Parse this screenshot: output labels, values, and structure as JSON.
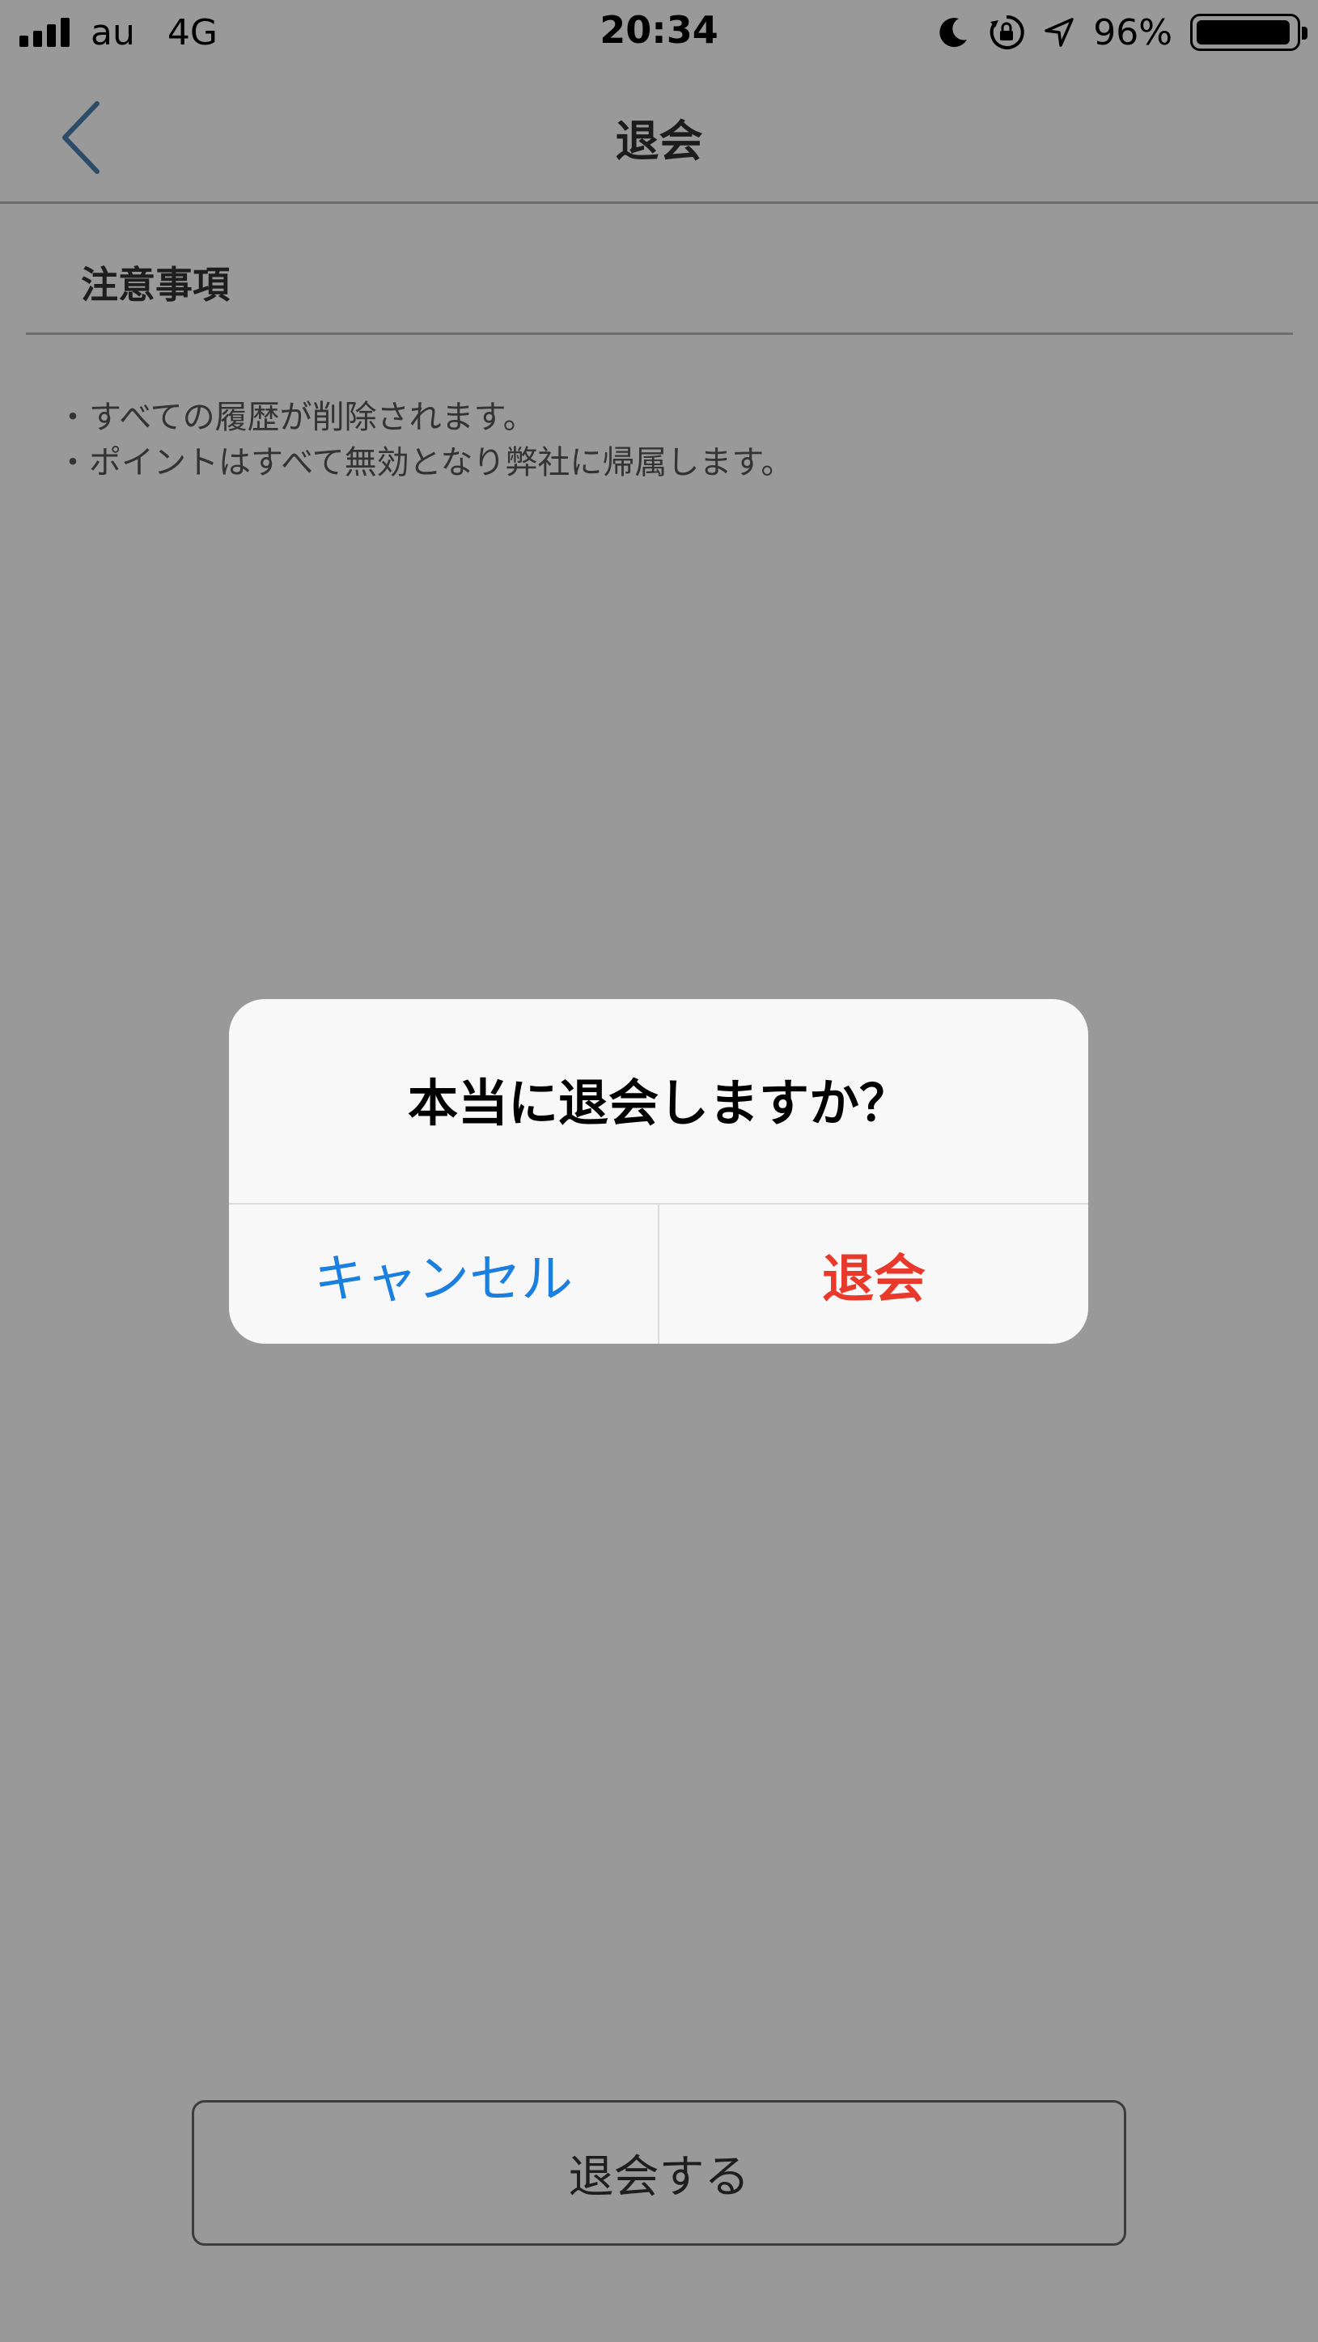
{
  "status_bar": {
    "carrier": "au",
    "network": "4G",
    "time": "20:34",
    "battery_percent": "96%",
    "battery_level": 0.96,
    "icons": [
      "signal-icon",
      "moon-icon",
      "rotation-lock-icon",
      "location-arrow-icon",
      "battery-icon"
    ]
  },
  "nav": {
    "back_icon": "chevron-left-icon",
    "title": "退会"
  },
  "section": {
    "title": "注意事項"
  },
  "notes": [
    "すべての履歴が削除されます。",
    "ポイントはすべて無効となり弊社に帰属します。"
  ],
  "withdraw_button": {
    "label": "退会する"
  },
  "dialog": {
    "title": "本当に退会しますか？",
    "cancel_label": "キャンセル",
    "confirm_label": "退会"
  },
  "colors": {
    "accent_blue": "#1a7fdf",
    "destructive_red": "#e8392b",
    "back_icon": "#4a7fb0"
  }
}
